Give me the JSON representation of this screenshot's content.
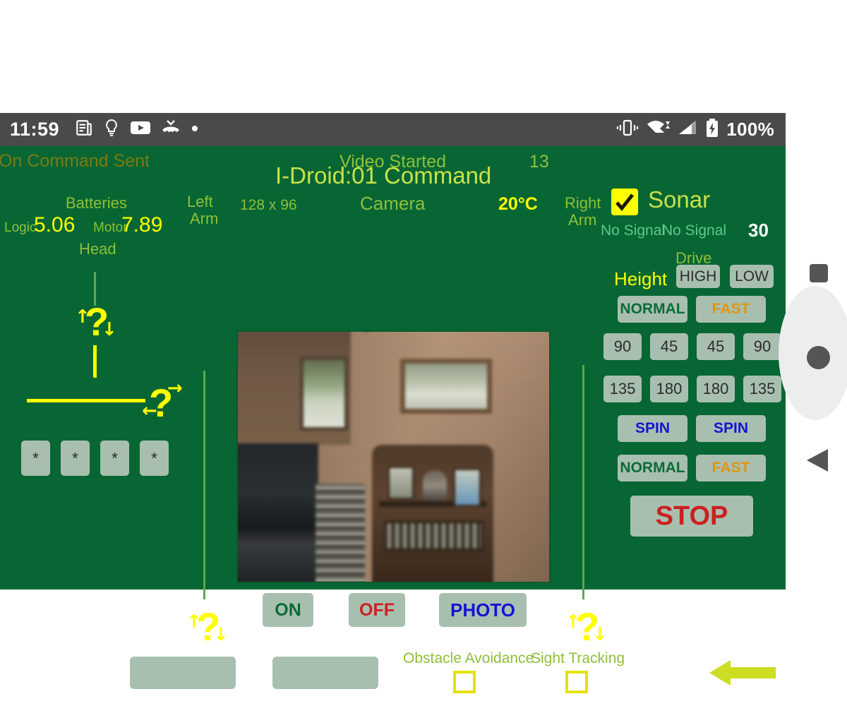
{
  "statusbar": {
    "clock": "11:59",
    "battery_pct": "100%",
    "icons": [
      "news-icon",
      "lightbulb-icon",
      "youtube-icon",
      "missed-call-icon",
      "dot-icon",
      "vibrate-icon",
      "wifi-icon",
      "cellular-signal-icon",
      "battery-icon"
    ]
  },
  "app": {
    "title": "I-Droid:01 Command",
    "status_left": "On Command Sent",
    "status_center": "Video Started",
    "status_count": "13"
  },
  "batteries": {
    "heading": "Batteries",
    "logic_label": "Logic",
    "logic_value": "5.06",
    "motor_label": "Motor",
    "motor_value": "7.89"
  },
  "head": {
    "label": "Head"
  },
  "arms": {
    "left": "Left\nArm",
    "left_l1": "Left",
    "left_l2": "Arm",
    "right_l1": "Right",
    "right_l2": "Arm"
  },
  "camera": {
    "resolution": "128 x 96",
    "label": "Camera",
    "temperature": "20°C",
    "on_label": "ON",
    "off_label": "OFF",
    "photo_label": "PHOTO"
  },
  "sonar": {
    "label": "Sonar",
    "checked": true,
    "left_reading": "No Signal",
    "right_reading": "No Signal",
    "value": "30"
  },
  "drive": {
    "heading": "Drive",
    "height_label": "Height",
    "height_high": "HIGH",
    "height_low": "LOW",
    "speed_normal_top": "NORMAL",
    "speed_fast_top": "FAST",
    "angles_row1": [
      "90",
      "45",
      "45",
      "90"
    ],
    "angles_row2": [
      "135",
      "180",
      "180",
      "135"
    ],
    "spin_left": "SPIN",
    "spin_right": "SPIN",
    "speed_normal_bottom": "NORMAL",
    "speed_fast_bottom": "FAST",
    "stop_label": "STOP"
  },
  "star_buttons": [
    "*",
    "*",
    "*",
    "*"
  ],
  "text_fields": {
    "field1": "",
    "field2": ""
  },
  "toggles": {
    "obstacle_label": "Obstacle Avoidance",
    "obstacle_checked": false,
    "sight_label": "Sight Tracking",
    "sight_checked": false
  },
  "knobs": {
    "head_glyph": "?",
    "head_up": "↑",
    "head_down": "↓",
    "body_glyph": "?",
    "body_left": "←",
    "body_right": "→",
    "left_arm_glyph": "?",
    "left_arm_up": "↑",
    "left_arm_down": "↓",
    "right_arm_glyph": "?",
    "right_arm_up": "↑",
    "right_arm_down": "↓"
  },
  "back_arrow": {
    "name": "back-arrow-indicator"
  },
  "navbar": {
    "recents": "recents-square",
    "home": "home-circle",
    "back": "back-triangle"
  },
  "colors": {
    "app_bg": "#076633",
    "statusbar_bg": "#4a4a4a",
    "button_bg": "#a8bfb0",
    "accent_yellow": "#ffff00",
    "label_green": "#8fbf3a",
    "title_yellowgreen": "#c8e24a",
    "stop_red": "#cc2020",
    "spin_blue": "#1414d2",
    "fast_orange": "#e0950f"
  }
}
